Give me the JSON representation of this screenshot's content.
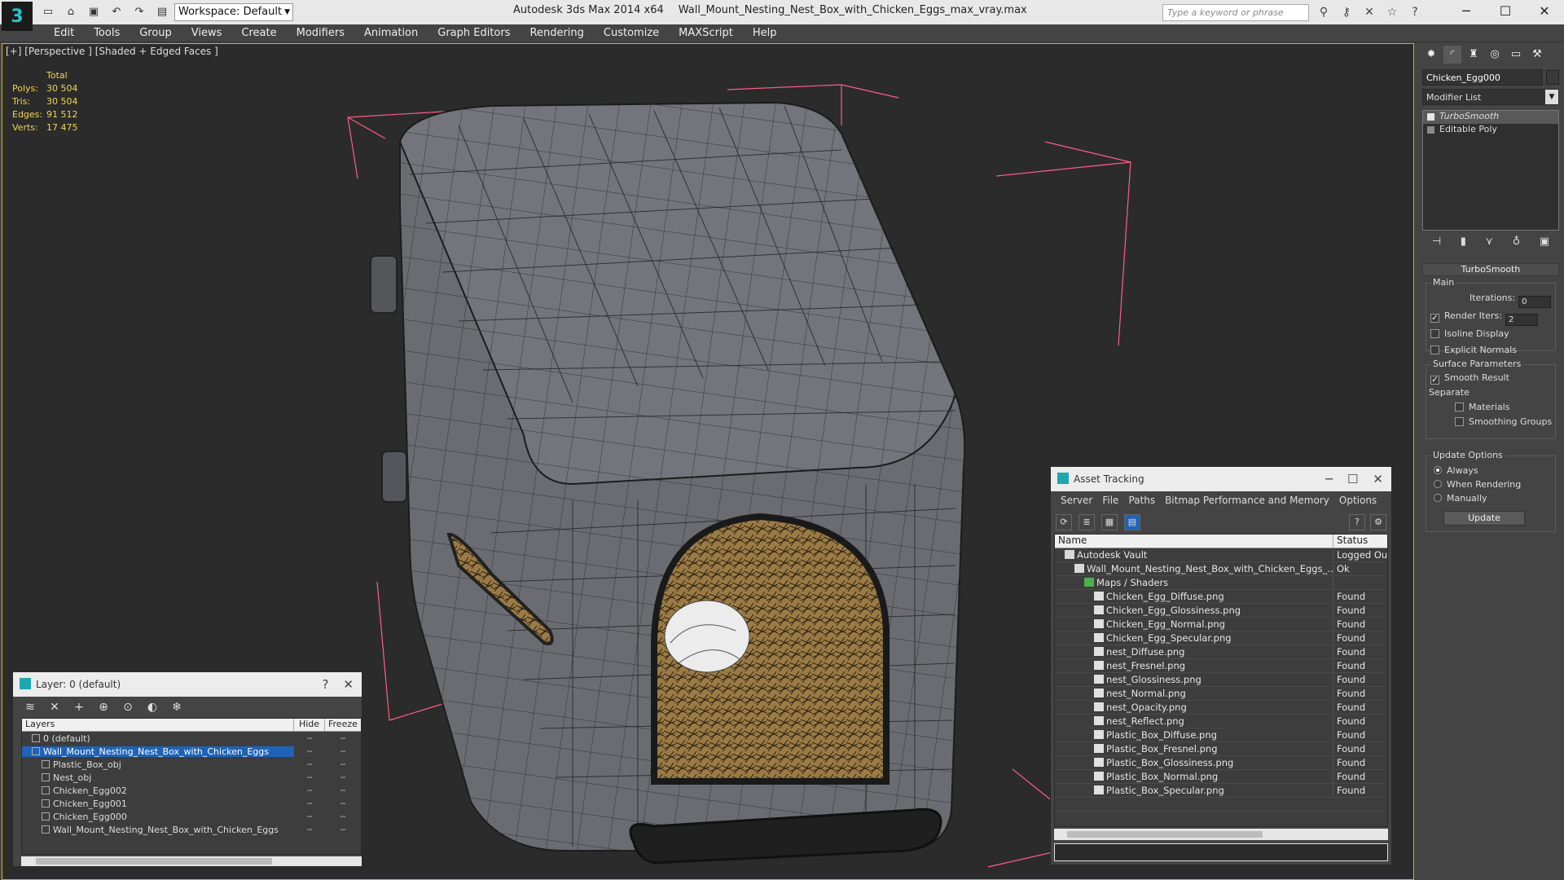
{
  "titlebar": {
    "workspace": "Workspace: Default",
    "app_title": "Autodesk 3ds Max  2014 x64",
    "file_title": "Wall_Mount_Nesting_Nest_Box_with_Chicken_Eggs_max_vray.max",
    "search_placeholder": "Type a keyword or phrase"
  },
  "menu": [
    "Edit",
    "Tools",
    "Group",
    "Views",
    "Create",
    "Modifiers",
    "Animation",
    "Graph Editors",
    "Rendering",
    "Customize",
    "MAXScript",
    "Help"
  ],
  "viewport": {
    "label": "[+] [Perspective ] [Shaded + Edged Faces ]",
    "stats_header": "Total",
    "stats": [
      {
        "k": "Polys:",
        "v": "30 504"
      },
      {
        "k": "Tris:",
        "v": "30 504"
      },
      {
        "k": "Edges:",
        "v": "91 512"
      },
      {
        "k": "Verts:",
        "v": "17 475"
      }
    ]
  },
  "layer_window": {
    "title": "Layer: 0 (default)",
    "help": "?",
    "columns": {
      "layers": "Layers",
      "hide": "Hide",
      "freeze": "Freeze"
    },
    "rows": [
      {
        "name": "0 (default)",
        "indent": 1,
        "selected": false
      },
      {
        "name": "Wall_Mount_Nesting_Nest_Box_with_Chicken_Eggs",
        "indent": 1,
        "selected": true
      },
      {
        "name": "Plastic_Box_obj",
        "indent": 2,
        "selected": false
      },
      {
        "name": "Nest_obj",
        "indent": 2,
        "selected": false
      },
      {
        "name": "Chicken_Egg002",
        "indent": 2,
        "selected": false
      },
      {
        "name": "Chicken_Egg001",
        "indent": 2,
        "selected": false
      },
      {
        "name": "Chicken_Egg000",
        "indent": 2,
        "selected": false
      },
      {
        "name": "Wall_Mount_Nesting_Nest_Box_with_Chicken_Eggs",
        "indent": 2,
        "selected": false
      }
    ]
  },
  "asset_window": {
    "title": "Asset Tracking",
    "menu": [
      "Server",
      "File",
      "Paths",
      "Bitmap Performance and Memory",
      "Options"
    ],
    "columns": {
      "name": "Name",
      "status": "Status"
    },
    "rows": [
      {
        "name": "Autodesk Vault",
        "status": "Logged Out",
        "indent": 1
      },
      {
        "name": "Wall_Mount_Nesting_Nest_Box_with_Chicken_Eggs_...",
        "status": "Ok",
        "indent": 2
      },
      {
        "name": "Maps / Shaders",
        "status": "",
        "indent": 3
      },
      {
        "name": "Chicken_Egg_Diffuse.png",
        "status": "Found",
        "indent": 4
      },
      {
        "name": "Chicken_Egg_Glossiness.png",
        "status": "Found",
        "indent": 4
      },
      {
        "name": "Chicken_Egg_Normal.png",
        "status": "Found",
        "indent": 4
      },
      {
        "name": "Chicken_Egg_Specular.png",
        "status": "Found",
        "indent": 4
      },
      {
        "name": "nest_Diffuse.png",
        "status": "Found",
        "indent": 4
      },
      {
        "name": "nest_Fresnel.png",
        "status": "Found",
        "indent": 4
      },
      {
        "name": "nest_Glossiness.png",
        "status": "Found",
        "indent": 4
      },
      {
        "name": "nest_Normal.png",
        "status": "Found",
        "indent": 4
      },
      {
        "name": "nest_Opacity.png",
        "status": "Found",
        "indent": 4
      },
      {
        "name": "nest_Reflect.png",
        "status": "Found",
        "indent": 4
      },
      {
        "name": "Plastic_Box_Diffuse.png",
        "status": "Found",
        "indent": 4
      },
      {
        "name": "Plastic_Box_Fresnel.png",
        "status": "Found",
        "indent": 4
      },
      {
        "name": "Plastic_Box_Glossiness.png",
        "status": "Found",
        "indent": 4
      },
      {
        "name": "Plastic_Box_Normal.png",
        "status": "Found",
        "indent": 4
      },
      {
        "name": "Plastic_Box_Specular.png",
        "status": "Found",
        "indent": 4
      }
    ]
  },
  "command_panel": {
    "object_name": "Chicken_Egg000",
    "modifier_list": "Modifier List",
    "stack": [
      "TurboSmooth",
      "Editable Poly"
    ],
    "rollout_title": "TurboSmooth",
    "main_group": "Main",
    "iterations_label": "Iterations:",
    "iterations_value": "0",
    "render_iters_label": "Render Iters:",
    "render_iters_value": "2",
    "isoline_display": "Isoline Display",
    "explicit_normals": "Explicit Normals",
    "surface_group": "Surface Parameters",
    "smooth_result": "Smooth Result",
    "separate_label": "Separate",
    "materials": "Materials",
    "smoothing_groups": "Smoothing Groups",
    "update_group": "Update Options",
    "always": "Always",
    "when_rendering": "When Rendering",
    "manually": "Manually",
    "update_button": "Update"
  },
  "colors": {
    "accent": "#1e63b8",
    "stats": "#f0d64f",
    "viewport_border": "#d6b300",
    "bbox": "#ff5c8a"
  }
}
